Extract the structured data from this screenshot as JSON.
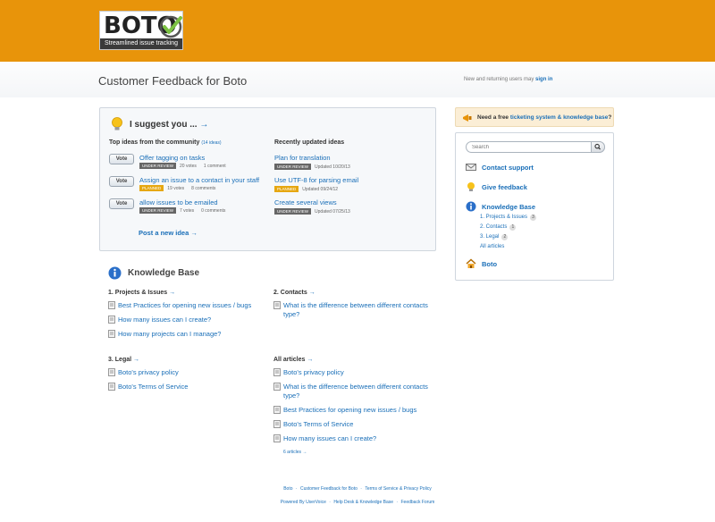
{
  "header": {
    "logo_text": "BOTO",
    "logo_tagline": "Streamlined issue tracking",
    "page_title": "Customer Feedback for Boto",
    "signin_prefix": "New and returning users may",
    "signin_link": "sign in"
  },
  "suggest": {
    "title": "I suggest you ...",
    "arrow": "→",
    "top_ideas_label": "Top ideas from the community",
    "top_ideas_count": "(14 ideas)",
    "recent_label": "Recently updated ideas",
    "vote_label": "Vote",
    "top_ideas": [
      {
        "title": "Offer tagging on tasks",
        "status": "UNDER REVIEW",
        "votes": "20 votes",
        "comments": "1 comment"
      },
      {
        "title": "Assign an issue to a contact in your staff",
        "status": "PLANNED",
        "votes": "19 votes",
        "comments": "8 comments"
      },
      {
        "title": "allow issues to be emailed",
        "status": "UNDER REVIEW",
        "votes": "7 votes",
        "comments": "0 comments"
      }
    ],
    "recent_ideas": [
      {
        "title": "Plan for translation",
        "status": "UNDER REVIEW",
        "updated": "Updated 10/20/13"
      },
      {
        "title": "Use UTF-8 for parsing email",
        "status": "PLANNED",
        "updated": "Updated 09/24/12"
      },
      {
        "title": "Create several views",
        "status": "UNDER REVIEW",
        "updated": "Updated 07/25/13"
      }
    ],
    "post_idea": "Post a new idea →"
  },
  "kb": {
    "title": "Knowledge Base",
    "sections": [
      {
        "title": "1. Projects & Issues",
        "articles": [
          "Best Practices for opening new issues / bugs",
          "How many issues can I create?",
          "How many projects can I manage?"
        ]
      },
      {
        "title": "2. Contacts",
        "articles": [
          "What is the difference between different contacts type?"
        ]
      },
      {
        "title": "3. Legal",
        "articles": [
          "Boto's privacy policy",
          "Boto's Terms of Service"
        ]
      },
      {
        "title": "All articles",
        "articles": [
          "Boto's privacy policy",
          "What is the difference between different contacts type?",
          "Best Practices for opening new issues / bugs",
          "Boto's Terms of Service",
          "How many issues can I create?"
        ],
        "more": "6 articles →"
      }
    ]
  },
  "sidebar": {
    "promo_prefix": "Need a free",
    "promo_link": "ticketing system & knowledge base",
    "promo_suffix": "?",
    "search_placeholder": "Search",
    "contact_support": "Contact support",
    "give_feedback": "Give feedback",
    "knowledge_base": "Knowledge Base",
    "kb_items": [
      {
        "label": "1. Projects & Issues",
        "count": "3"
      },
      {
        "label": "2. Contacts",
        "count": "1"
      },
      {
        "label": "3. Legal",
        "count": "2"
      }
    ],
    "all_articles": "All articles",
    "home": "Boto"
  },
  "footer": {
    "line1": [
      "Boto",
      "Customer Feedback for Boto",
      "Terms of Service & Privacy Policy"
    ],
    "line2": [
      "Powered By UserVoice",
      "Help Desk & Knowledge Base",
      "Feedback Forum"
    ]
  },
  "colors": {
    "header": "#e8940a",
    "link": "#1a6fb8",
    "planned": "#e6a711",
    "review": "#666666"
  }
}
